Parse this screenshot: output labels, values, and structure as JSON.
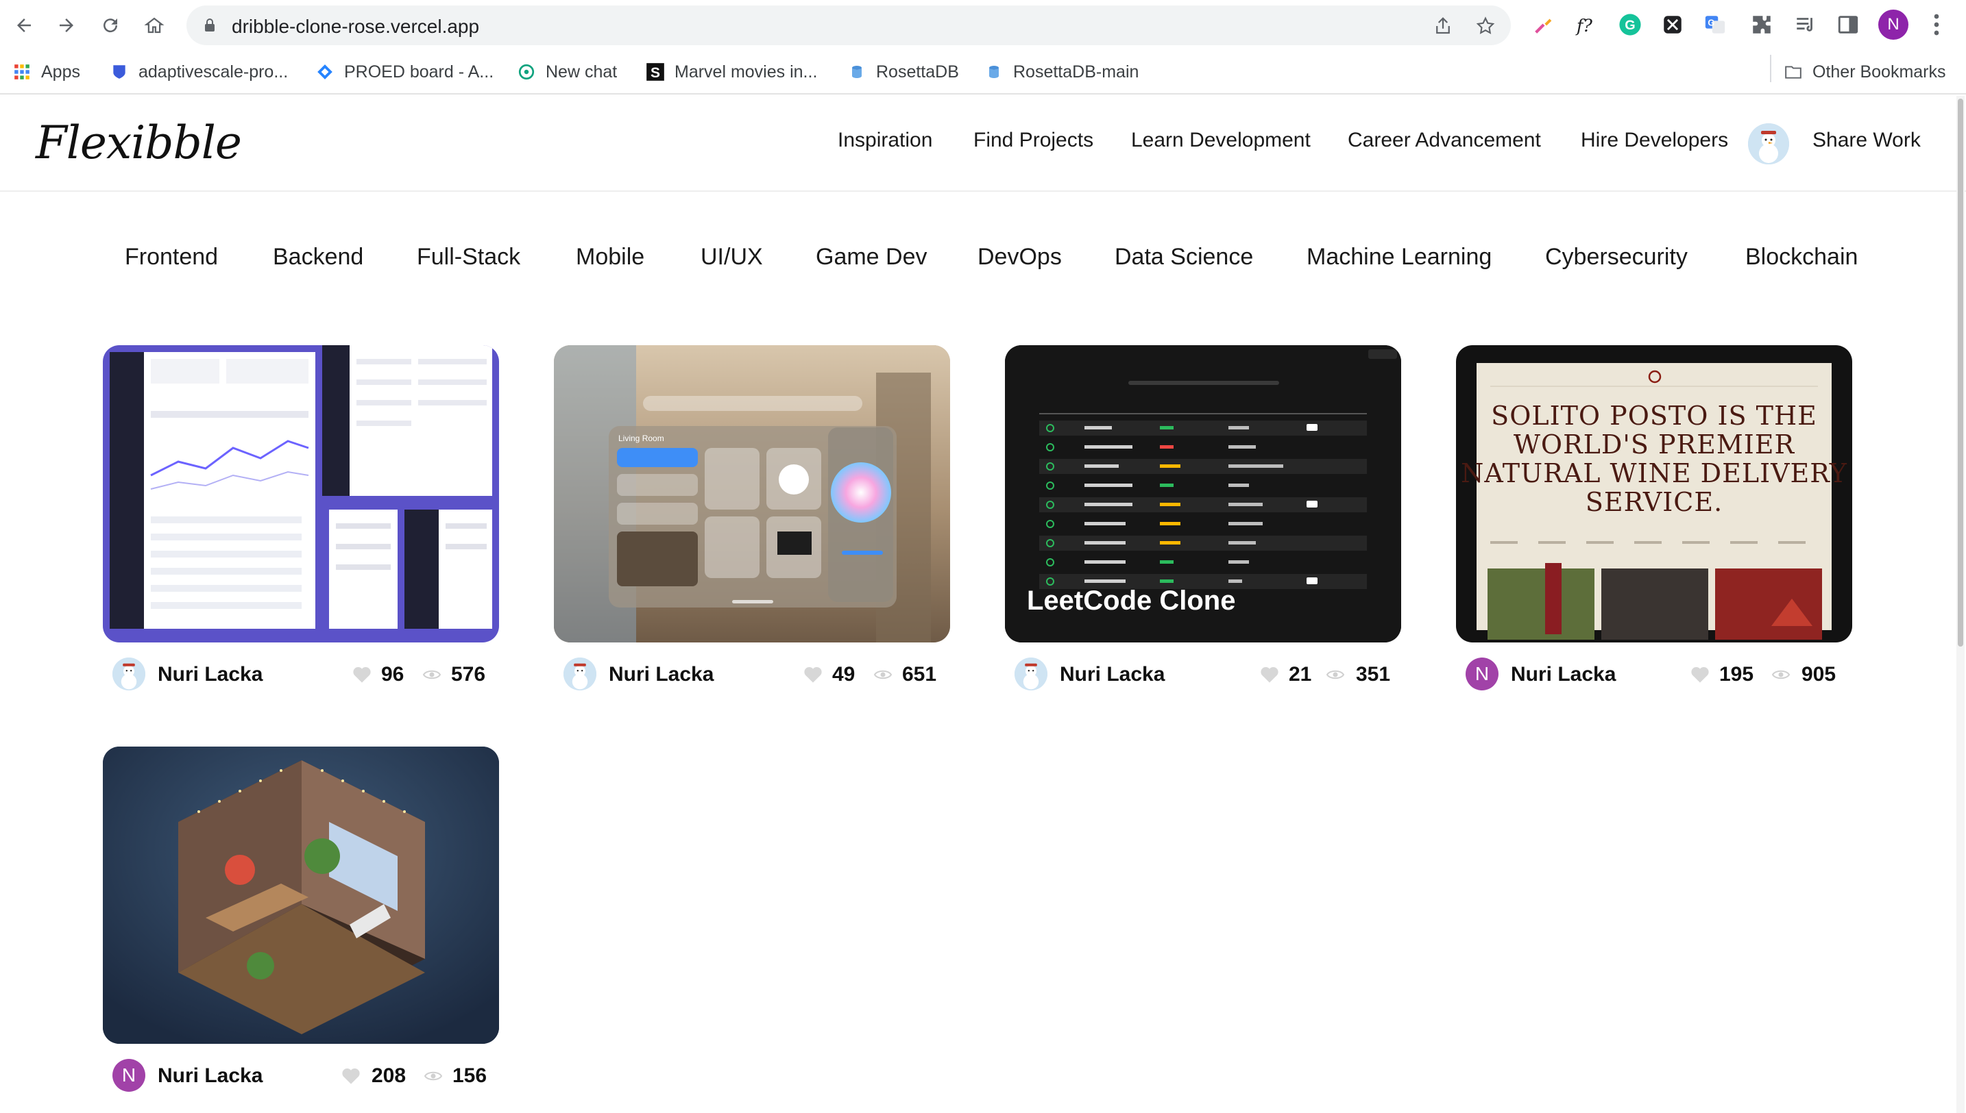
{
  "browser": {
    "url": "dribble-clone-rose.vercel.app",
    "profile_initial": "N",
    "bookmarks": [
      {
        "label": "Apps",
        "icon": "apps-grid-icon"
      },
      {
        "label": "adaptivescale-pro...",
        "icon": "shield-icon"
      },
      {
        "label": "PROED board - A...",
        "icon": "jira-diamond-icon"
      },
      {
        "label": "New chat",
        "icon": "openai-icon"
      },
      {
        "label": "Marvel movies in...",
        "icon": "s-logo-icon"
      },
      {
        "label": "RosettaDB",
        "icon": "database-icon"
      },
      {
        "label": "RosettaDB-main",
        "icon": "database-icon"
      }
    ],
    "other_bookmarks": "Other Bookmarks"
  },
  "site": {
    "logo": "Flexibble",
    "nav_links": [
      "Inspiration",
      "Find Projects",
      "Learn Development",
      "Career Advancement",
      "Hire Developers"
    ],
    "share_label": "Share Work"
  },
  "categories": [
    "Frontend",
    "Backend",
    "Full-Stack",
    "Mobile",
    "UI/UX",
    "Game Dev",
    "DevOps",
    "Data Science",
    "Machine Learning",
    "Cybersecurity",
    "Blockchain"
  ],
  "projects": [
    {
      "author": "Nuri Lacka",
      "likes": "96",
      "views": "576",
      "avatar": "snowman"
    },
    {
      "author": "Nuri Lacka",
      "likes": "49",
      "views": "651",
      "avatar": "snowman",
      "image_text": "Living Room"
    },
    {
      "author": "Nuri Lacka",
      "likes": "21",
      "views": "351",
      "avatar": "snowman",
      "image_text": "LeetCode Clone"
    },
    {
      "author": "Nuri Lacka",
      "likes": "195",
      "views": "905",
      "avatar_initial": "N",
      "image_text": "SOLITO POSTO IS THE WORLD'S PREMIER NATURAL WINE DELIVERY SERVICE."
    },
    {
      "author": "Nuri Lacka",
      "likes": "208",
      "views": "156",
      "avatar_initial": "N"
    }
  ],
  "colors": {
    "profile_purple": "#8e24aa",
    "avatar_purple": "#a142a8",
    "card1_bg": "#5b52c8",
    "card3_bg": "#141414",
    "card4_bg": "#ece6d8",
    "card5_bg": "#283a55"
  }
}
